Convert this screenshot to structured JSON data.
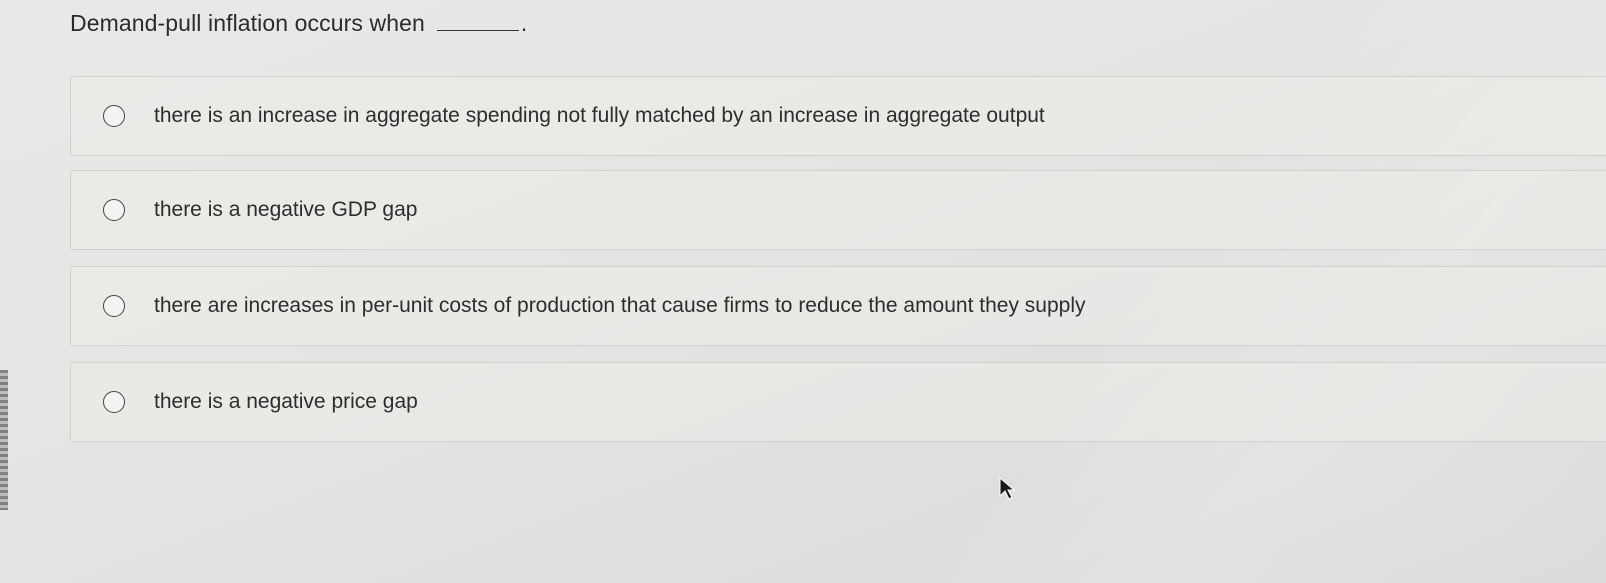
{
  "question": {
    "prompt": "Demand-pull inflation occurs when",
    "end_mark": "."
  },
  "options": [
    {
      "label": "there is an increase in aggregate spending not fully matched by an increase in aggregate output",
      "selected": false
    },
    {
      "label": "there is a negative GDP gap",
      "selected": false
    },
    {
      "label": "there are increases in per-unit costs of production that cause firms to reduce the amount they supply",
      "selected": false
    },
    {
      "label": "there is a negative price gap",
      "selected": false
    }
  ],
  "icons": {
    "radio": "radio-button-icon",
    "cursor": "mouse-pointer-icon"
  },
  "colors": {
    "background": "#e6e6e4",
    "text": "#2b2b2b",
    "option_border": "#cfcfcd"
  }
}
